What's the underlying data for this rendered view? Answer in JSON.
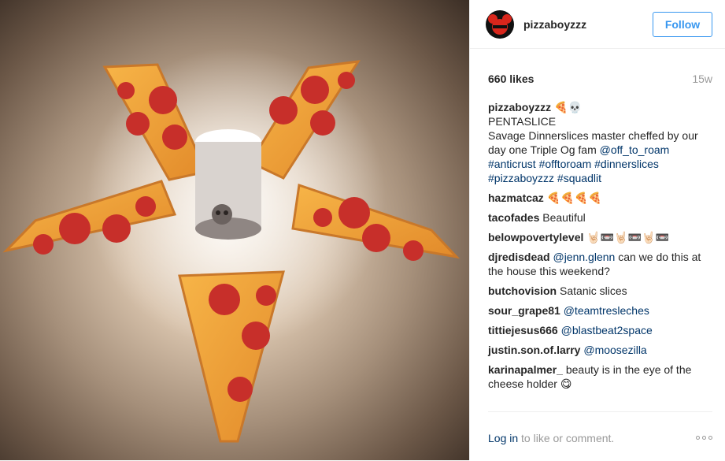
{
  "post": {
    "username": "pizzaboyzzz",
    "follow_label": "Follow",
    "likes": "660 likes",
    "age": "15w",
    "caption": {
      "author": "pizzaboyzzz",
      "emoji": "🍕💀",
      "title": "PENTASLICE",
      "text": "Savage Dinnerslices master cheffed by our day one Triple Og fam",
      "mention": "@off_to_roam",
      "tags_line1": "#anticrust #offtoroam #dinnerslices",
      "tags_line2": "#pizzaboyzzz #squadlit"
    },
    "comments": [
      {
        "author": "hazmatcaz",
        "text": "🍕🍕🍕🍕"
      },
      {
        "author": "tacofades",
        "text": "Beautiful"
      },
      {
        "author": "belowpovertylevel",
        "text": "🤘🏻📼🤘🏻📼🤘🏻📼"
      },
      {
        "author": "djredisdead",
        "mention": "@jenn.glenn",
        "text": "can we do this at the house this weekend?"
      },
      {
        "author": "butchovision",
        "text": "Satanic slices"
      },
      {
        "author": "sour_grape81",
        "mention": "@teamtresleches"
      },
      {
        "author": "tittiejesus666",
        "mention": "@blastbeat2space"
      },
      {
        "author": "justin.son.of.larry",
        "mention": "@moosezilla"
      },
      {
        "author": "karinapalmer_",
        "text": "beauty is in the eye of the cheese holder 😋"
      }
    ],
    "footer": {
      "login_link": "Log in",
      "login_rest": "to like or comment."
    }
  },
  "icons": {
    "avatar": "mouse-ears-logo-icon",
    "more": "more-options-icon"
  },
  "colors": {
    "accent": "#3897f0",
    "link": "#003569",
    "muted": "#999999",
    "text": "#262626"
  }
}
